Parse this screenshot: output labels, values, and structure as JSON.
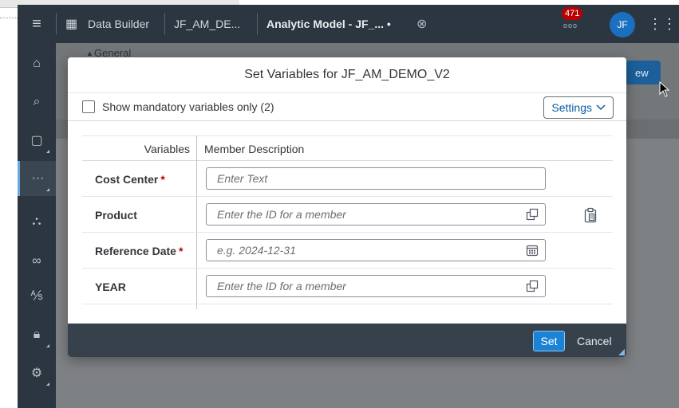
{
  "shell": {
    "app_title": "Data Builder",
    "breadcrumb": "JF_AM_DE...",
    "model_title": "Analytic Model - JF_... •",
    "notification_count": "471",
    "notification_dots": "ooo",
    "avatar_initials": "JF"
  },
  "page": {
    "section_label": "General",
    "preview_button_partial": "ew"
  },
  "dialog": {
    "title": "Set Variables for JF_AM_DEMO_V2",
    "show_mandatory_label": "Show mandatory variables only (2)",
    "settings_label": "Settings",
    "columns": {
      "variables": "Variables",
      "description": "Member Description"
    },
    "rows": [
      {
        "label": "Cost Center",
        "required": "*",
        "placeholder": "Enter Text"
      },
      {
        "label": "Product",
        "required": "",
        "placeholder": "Enter the ID for a member"
      },
      {
        "label": "Reference Date",
        "required": "*",
        "placeholder": "e.g. 2024-12-31"
      },
      {
        "label": "YEAR",
        "required": "",
        "placeholder": "Enter the ID for a member"
      }
    ],
    "set_label": "Set",
    "cancel_label": "Cancel"
  },
  "icons": {
    "menu": "hamburger-icon",
    "value_help": "value-help-icon",
    "calendar": "calendar-icon",
    "paste": "paste-icon"
  },
  "colors": {
    "shell_bg": "#2b3640",
    "footer_bg": "#36414c",
    "primary_button": "#1a83d6",
    "required": "#bb0000",
    "link": "#0a5aa0"
  }
}
